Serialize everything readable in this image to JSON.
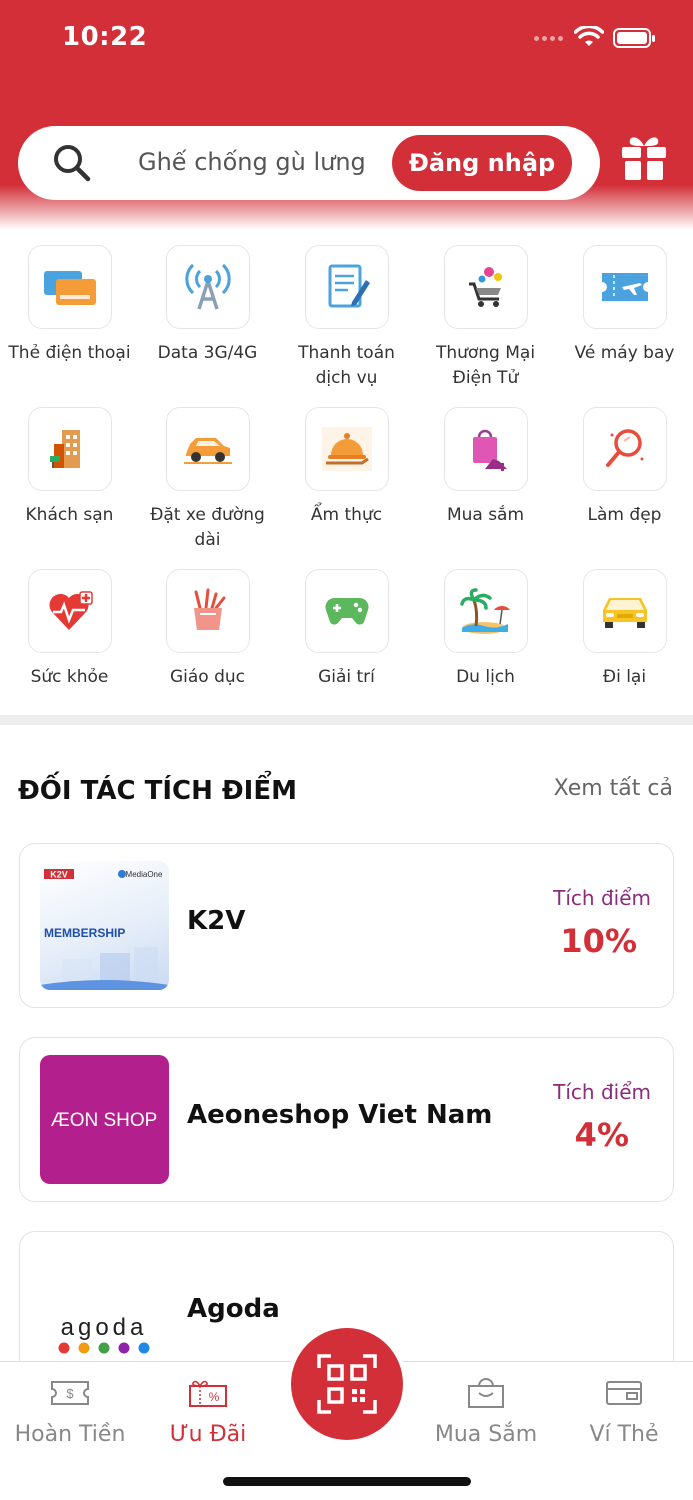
{
  "status": {
    "time": "10:22"
  },
  "search": {
    "placeholder": "Ghế chống gù lưng",
    "login_label": "Đăng nhập"
  },
  "categories": [
    {
      "label": "Thẻ điện thoại",
      "icon": "phone-card-icon"
    },
    {
      "label": "Data 3G/4G",
      "icon": "antenna-icon"
    },
    {
      "label": "Thanh toán dịch vụ",
      "icon": "bill-payment-icon"
    },
    {
      "label": "Thương Mại Điện Tử",
      "icon": "ecommerce-cart-icon"
    },
    {
      "label": "Vé máy bay",
      "icon": "plane-ticket-icon"
    },
    {
      "label": "Khách sạn",
      "icon": "hotel-icon"
    },
    {
      "label": "Đặt xe đường dài",
      "icon": "car-booking-icon"
    },
    {
      "label": "Ẩm thực",
      "icon": "food-cloche-icon"
    },
    {
      "label": "Mua sắm",
      "icon": "shopping-bag-icon"
    },
    {
      "label": "Làm đẹp",
      "icon": "beauty-mirror-icon"
    },
    {
      "label": "Sức khỏe",
      "icon": "health-heart-icon"
    },
    {
      "label": "Giáo dục",
      "icon": "education-icon"
    },
    {
      "label": "Giải trí",
      "icon": "gamepad-icon"
    },
    {
      "label": "Du lịch",
      "icon": "beach-icon"
    },
    {
      "label": "Đi lại",
      "icon": "taxi-icon"
    }
  ],
  "partners_section": {
    "title": "ĐỐI TÁC TÍCH ĐIỂM",
    "see_all": "Xem tất cả"
  },
  "partners": [
    {
      "name": "K2V",
      "points_label": "Tích điểm",
      "points_value": "10%",
      "logo_text": [
        "K2V",
        "MediaOne",
        "MEMBERSHIP"
      ]
    },
    {
      "name": "Aeoneshop Viet Nam",
      "points_label": "Tích điểm",
      "points_value": "4%",
      "logo_text": "ÆON SHOP"
    },
    {
      "name": "Agoda",
      "logo_text": "agoda"
    }
  ],
  "bottom_nav": [
    {
      "label": "Hoàn Tiền",
      "icon": "cashback-icon"
    },
    {
      "label": "Ưu Đãi",
      "icon": "voucher-icon",
      "active": true
    },
    {
      "label": "Mua Sắm",
      "icon": "shopping-bag-icon"
    },
    {
      "label": "Ví Thẻ",
      "icon": "wallet-card-icon"
    }
  ],
  "colors": {
    "brand": "#d32f38",
    "points_label": "#8b2d7a",
    "aeon_bg": "#b31f8c"
  }
}
